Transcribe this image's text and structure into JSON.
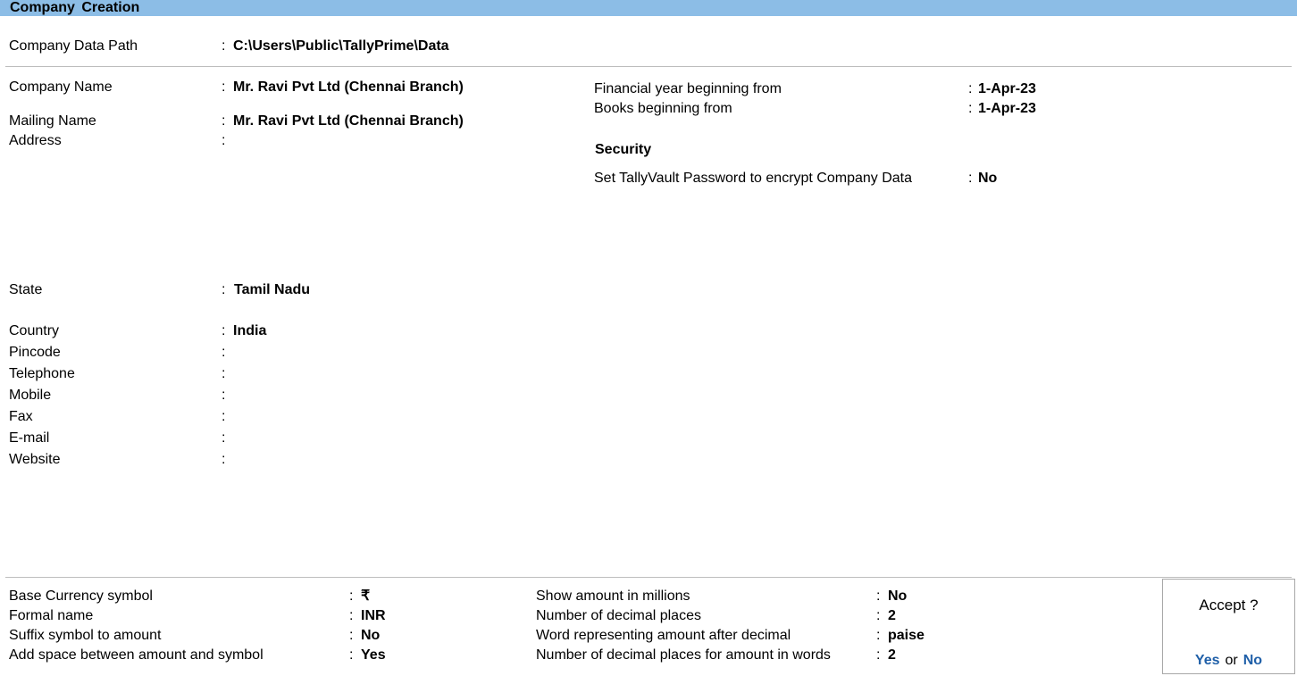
{
  "title": "Company  Creation",
  "data_path": {
    "label": "Company Data Path",
    "value": "C:\\Users\\Public\\TallyPrime\\Data"
  },
  "left_fields": {
    "company_name": {
      "label": "Company Name",
      "value": "Mr. Ravi Pvt Ltd (Chennai Branch)"
    },
    "mailing_name": {
      "label": "Mailing Name",
      "value": "Mr. Ravi Pvt Ltd (Chennai Branch)"
    },
    "address": {
      "label": "Address",
      "value": ""
    },
    "state": {
      "label": "State",
      "value": "Tamil Nadu"
    },
    "country": {
      "label": "Country",
      "value": "India"
    },
    "pincode": {
      "label": "Pincode",
      "value": ""
    },
    "telephone": {
      "label": "Telephone",
      "value": ""
    },
    "mobile": {
      "label": "Mobile",
      "value": ""
    },
    "fax": {
      "label": "Fax",
      "value": ""
    },
    "email": {
      "label": "E-mail",
      "value": ""
    },
    "website": {
      "label": "Website",
      "value": ""
    }
  },
  "right_fields": {
    "fy_begin": {
      "label": "Financial year beginning from",
      "value": "1-Apr-23"
    },
    "books_begin": {
      "label": "Books beginning from",
      "value": "1-Apr-23"
    },
    "security_heading": "Security",
    "tallyvault": {
      "label": "Set TallyVault Password to encrypt Company Data",
      "value": "No"
    }
  },
  "currency": {
    "base_symbol": {
      "label": "Base Currency symbol",
      "value": "₹"
    },
    "formal_name": {
      "label": "Formal name",
      "value": "INR"
    },
    "suffix_symbol": {
      "label": "Suffix symbol to amount",
      "value": "No"
    },
    "add_space": {
      "label": "Add space between amount and symbol",
      "value": "Yes"
    },
    "show_millions": {
      "label": "Show amount in millions",
      "value": "No"
    },
    "decimal_places": {
      "label": "Number of decimal places",
      "value": "2"
    },
    "word_after_decimal": {
      "label": "Word representing amount after decimal",
      "value": "paise"
    },
    "decimal_places_words": {
      "label": "Number of decimal places for amount in words",
      "value": "2"
    }
  },
  "accept": {
    "question": "Accept ?",
    "yes": "Yes",
    "or": "or",
    "no": "No"
  },
  "colors": {
    "title_bar": "#8cbde6",
    "accept_option": "#1f5fa8"
  },
  "colon": ":"
}
